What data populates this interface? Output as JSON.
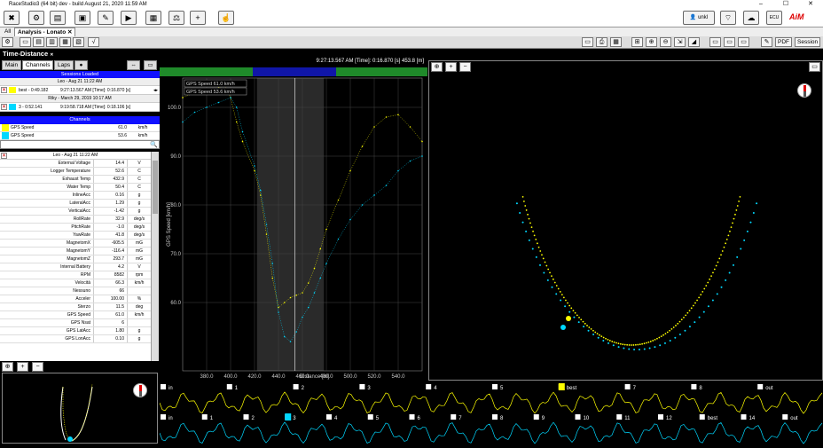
{
  "window": {
    "title": "RaceStudio3 (64 bit) dev  - build August 21, 2020 11:59 AM"
  },
  "toolbar": {
    "user_label": "unkl",
    "wifi_label": "WiFi",
    "ecu_label": "ECU"
  },
  "tabs": {
    "all_label": "All",
    "analysis_label": "Analysis - Lonato"
  },
  "iconbar": {
    "pdf_label": "PDF",
    "session_label": "Session"
  },
  "workspace": {
    "title": "Time-Distance"
  },
  "sidetabs": {
    "main": "Main",
    "channels": "Channels",
    "laps": "Laps"
  },
  "sessions": {
    "header": "Sessions Loaded",
    "groups": [
      {
        "name": "Leo - Aug 21 11:22 AM",
        "laps": [
          {
            "label": "best - 0:49.182",
            "time": "9:27:13.567 AM [Time]: 0:16.870 [s]",
            "color": "#ffff00"
          }
        ]
      },
      {
        "name": "Riky - March 29, 2019 10:17 AM",
        "laps": [
          {
            "label": "3 - 0:52.141",
            "time": "9:19:58.718 AM [Time]: 0:18.106 [s]",
            "color": "#00d8ff"
          }
        ]
      }
    ]
  },
  "channels": {
    "header": "Channels",
    "rows": [
      {
        "name": "GPS Speed",
        "value": "61.0",
        "unit": "km/h",
        "color": "#ffff00"
      },
      {
        "name": "GPS Speed",
        "value": "53.6",
        "unit": "km/h",
        "color": "#00d8ff"
      }
    ]
  },
  "values": {
    "session": "Leo - Aug 21 11:22 AM",
    "rows": [
      {
        "name": "External Voltage",
        "value": "14.4",
        "unit": "V"
      },
      {
        "name": "Logger Temperature",
        "value": "52.6",
        "unit": "C"
      },
      {
        "name": "Exhaust Temp",
        "value": "432.9",
        "unit": "C"
      },
      {
        "name": "Water Temp",
        "value": "50.4",
        "unit": "C"
      },
      {
        "name": "InlineAcc",
        "value": "0.16",
        "unit": "g"
      },
      {
        "name": "LateralAcc",
        "value": "1.29",
        "unit": "g"
      },
      {
        "name": "VerticalAcc",
        "value": "-1.42",
        "unit": "g"
      },
      {
        "name": "RollRate",
        "value": "32.9",
        "unit": "deg/s"
      },
      {
        "name": "PitchRate",
        "value": "-1.0",
        "unit": "deg/s"
      },
      {
        "name": "YawRate",
        "value": "41.8",
        "unit": "deg/s"
      },
      {
        "name": "MagnetomX",
        "value": "-605.5",
        "unit": "mG"
      },
      {
        "name": "MagnetomY",
        "value": "-116.4",
        "unit": "mG"
      },
      {
        "name": "MagnetomZ",
        "value": "293.7",
        "unit": "mG"
      },
      {
        "name": "Internal Battery",
        "value": "4.2",
        "unit": "V"
      },
      {
        "name": "RPM",
        "value": "8582",
        "unit": "rpm"
      },
      {
        "name": "Velocità",
        "value": "66.3",
        "unit": "km/h"
      },
      {
        "name": "Nessuno",
        "value": "66",
        "unit": ""
      },
      {
        "name": "Acceler",
        "value": "100.00",
        "unit": "%"
      },
      {
        "name": "Sterzo",
        "value": "11.5",
        "unit": "deg"
      },
      {
        "name": "GPS Speed",
        "value": "61.0",
        "unit": "km/h"
      },
      {
        "name": "GPS Nsat",
        "value": "6",
        "unit": ""
      },
      {
        "name": "GPS LatAcc",
        "value": "1.80",
        "unit": "g"
      },
      {
        "name": "GPS LonAcc",
        "value": "0.10",
        "unit": "g"
      }
    ]
  },
  "chart": {
    "cursor_readout": "9:27:13.567 AM [Time]: 0:16.870 [s]  453.8 [m]",
    "legend": [
      "GPS Speed  61.0  km/h",
      "GPS Speed  53.6  km/h"
    ]
  },
  "chart_data": {
    "type": "line",
    "title": "",
    "xlabel": "Distance [m]",
    "ylabel": "GPS Speed [km/h]",
    "xlim": [
      360,
      560
    ],
    "ylim": [
      46,
      106
    ],
    "x_ticks": [
      380,
      400,
      420,
      440,
      460,
      480,
      500,
      520,
      540
    ],
    "y_ticks": [
      60,
      70,
      80,
      90,
      100
    ],
    "grid": true,
    "cursor_x": 453.8,
    "series": [
      {
        "color": "#ffff00",
        "x": [
          360,
          370,
          380,
          390,
          395,
          400,
          405,
          410,
          420,
          425,
          430,
          435,
          440,
          445,
          450,
          455,
          460,
          465,
          470,
          475,
          480,
          490,
          500,
          510,
          520,
          530,
          540,
          550,
          560
        ],
        "y": [
          102,
          103,
          103,
          104,
          104.5,
          102,
          97,
          93,
          87,
          82,
          74,
          65,
          59,
          60,
          61,
          61.5,
          62,
          64,
          67,
          71,
          75,
          81,
          87,
          92,
          96,
          98,
          98.5,
          96,
          93
        ]
      },
      {
        "color": "#00d8ff",
        "x": [
          360,
          370,
          380,
          390,
          400,
          405,
          410,
          420,
          425,
          430,
          435,
          440,
          445,
          450,
          455,
          460,
          465,
          470,
          475,
          480,
          490,
          500,
          510,
          520,
          530,
          540,
          550,
          560
        ],
        "y": [
          97,
          99,
          100,
          101,
          102,
          100,
          95,
          88,
          83,
          76,
          68,
          58,
          53,
          52,
          54,
          57,
          59,
          62,
          65,
          68,
          73,
          77,
          80,
          82,
          84,
          87,
          89,
          90
        ]
      }
    ]
  },
  "lapbars": {
    "row1": [
      "in",
      "1",
      "2",
      "3",
      "4",
      "5",
      "best",
      "7",
      "8",
      "out"
    ],
    "row2": [
      "in",
      "1",
      "2",
      "3",
      "4",
      "5",
      "6",
      "7",
      "8",
      "9",
      "10",
      "11",
      "12",
      "best",
      "14",
      "out"
    ]
  }
}
